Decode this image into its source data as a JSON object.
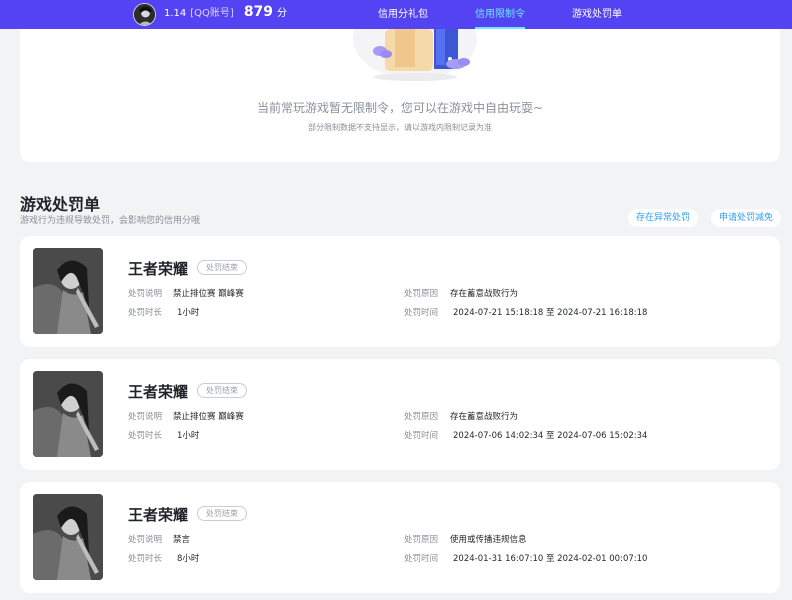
{
  "header": {
    "user_id": "1.14",
    "account_label": "[QQ账号]",
    "score": "879",
    "score_unit": "分",
    "nav": [
      {
        "label": "信用分礼包",
        "active": false
      },
      {
        "label": "信用限制令",
        "active": true
      },
      {
        "label": "游戏处罚单",
        "active": false
      }
    ],
    "colors": {
      "bar": "#5443f3",
      "active_tab": "#6ee7ff"
    }
  },
  "restriction": {
    "message": "当前常玩游戏暂无限制令，您可以在游戏中自由玩耍~",
    "note": "部分限制数据不支持显示，请以游戏内限制记录为准"
  },
  "penalty_section": {
    "title": "游戏处罚单",
    "description": "游戏行为违规导致处罚，会影响您的信用分哦",
    "buttons": [
      {
        "label": "存在异常处罚"
      },
      {
        "label": "申请处罚减免"
      }
    ],
    "field_labels": {
      "description": "处罚说明",
      "duration": "处罚时长",
      "reason": "处罚原因",
      "time": "处罚时间"
    },
    "items": [
      {
        "game": "王者荣耀",
        "status": "处罚结束",
        "description": "禁止排位赛 巅峰赛",
        "duration": "1小时",
        "reason": "存在蓄意战败行为",
        "time": "2024-07-21 15:18:18 至 2024-07-21 16:18:18"
      },
      {
        "game": "王者荣耀",
        "status": "处罚结束",
        "description": "禁止排位赛 巅峰赛",
        "duration": "1小时",
        "reason": "存在蓄意战败行为",
        "time": "2024-07-06 14:02:34 至 2024-07-06 15:02:34"
      },
      {
        "game": "王者荣耀",
        "status": "处罚结束",
        "description": "禁言",
        "duration": "8小时",
        "reason": "使用或传播违规信息",
        "time": "2024-01-31 16:07:10 至 2024-02-01 00:07:10"
      }
    ]
  }
}
